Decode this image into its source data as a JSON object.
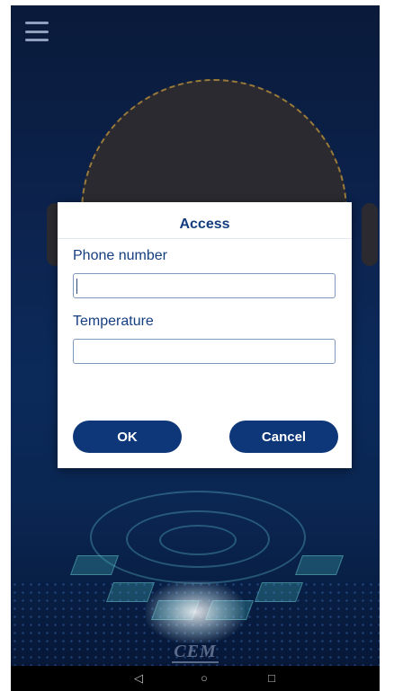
{
  "dialog": {
    "title": "Access",
    "phone_label": "Phone number",
    "phone_value": "",
    "temperature_label": "Temperature",
    "temperature_value": "",
    "ok_label": "OK",
    "cancel_label": "Cancel"
  },
  "brand": {
    "text": "CEM"
  },
  "navbar": {
    "back_glyph": "◁",
    "home_glyph": "○",
    "recent_glyph": "□"
  },
  "icons": {
    "menu": "hamburger-menu-icon",
    "back": "back-triangle-icon",
    "home": "home-circle-icon",
    "recent": "recent-apps-square-icon"
  },
  "colors": {
    "primary": "#0d3778",
    "title": "#123c7e",
    "background_top": "#0a1a3a",
    "background_bottom": "#061533"
  }
}
